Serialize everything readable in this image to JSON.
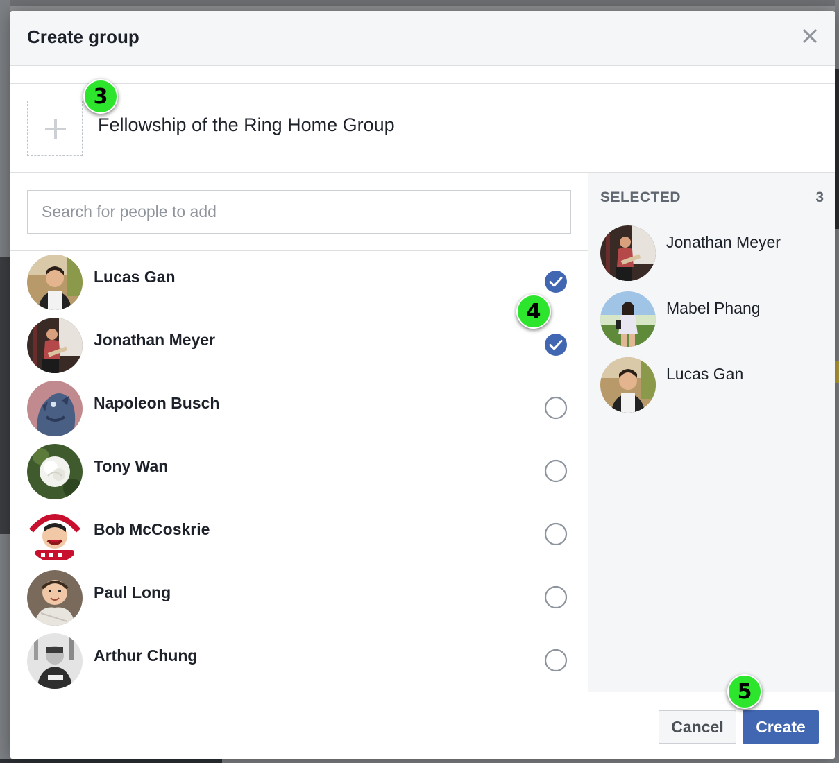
{
  "modal": {
    "title": "Create group",
    "close_icon": "close-icon"
  },
  "group": {
    "name": "Fellowship of the Ring Home Group",
    "photo_icon": "plus-icon"
  },
  "search": {
    "placeholder": "Search for people to add",
    "value": ""
  },
  "friends": [
    {
      "name": "Lucas Gan",
      "checked": true
    },
    {
      "name": "Jonathan Meyer",
      "checked": true
    },
    {
      "name": "Napoleon Busch",
      "checked": false
    },
    {
      "name": "Tony Wan",
      "checked": false
    },
    {
      "name": "Bob McCoskrie",
      "checked": false
    },
    {
      "name": "Paul Long",
      "checked": false
    },
    {
      "name": "Arthur Chung",
      "checked": false
    }
  ],
  "selected": {
    "label": "SELECTED",
    "count": "3",
    "items": [
      {
        "name": "Jonathan Meyer"
      },
      {
        "name": "Mabel Phang"
      },
      {
        "name": "Lucas Gan"
      }
    ]
  },
  "footer": {
    "cancel_label": "Cancel",
    "create_label": "Create"
  },
  "steps": [
    "3",
    "4",
    "5"
  ],
  "colors": {
    "accent": "#4267b2",
    "step_badge": "#2ee52e"
  }
}
